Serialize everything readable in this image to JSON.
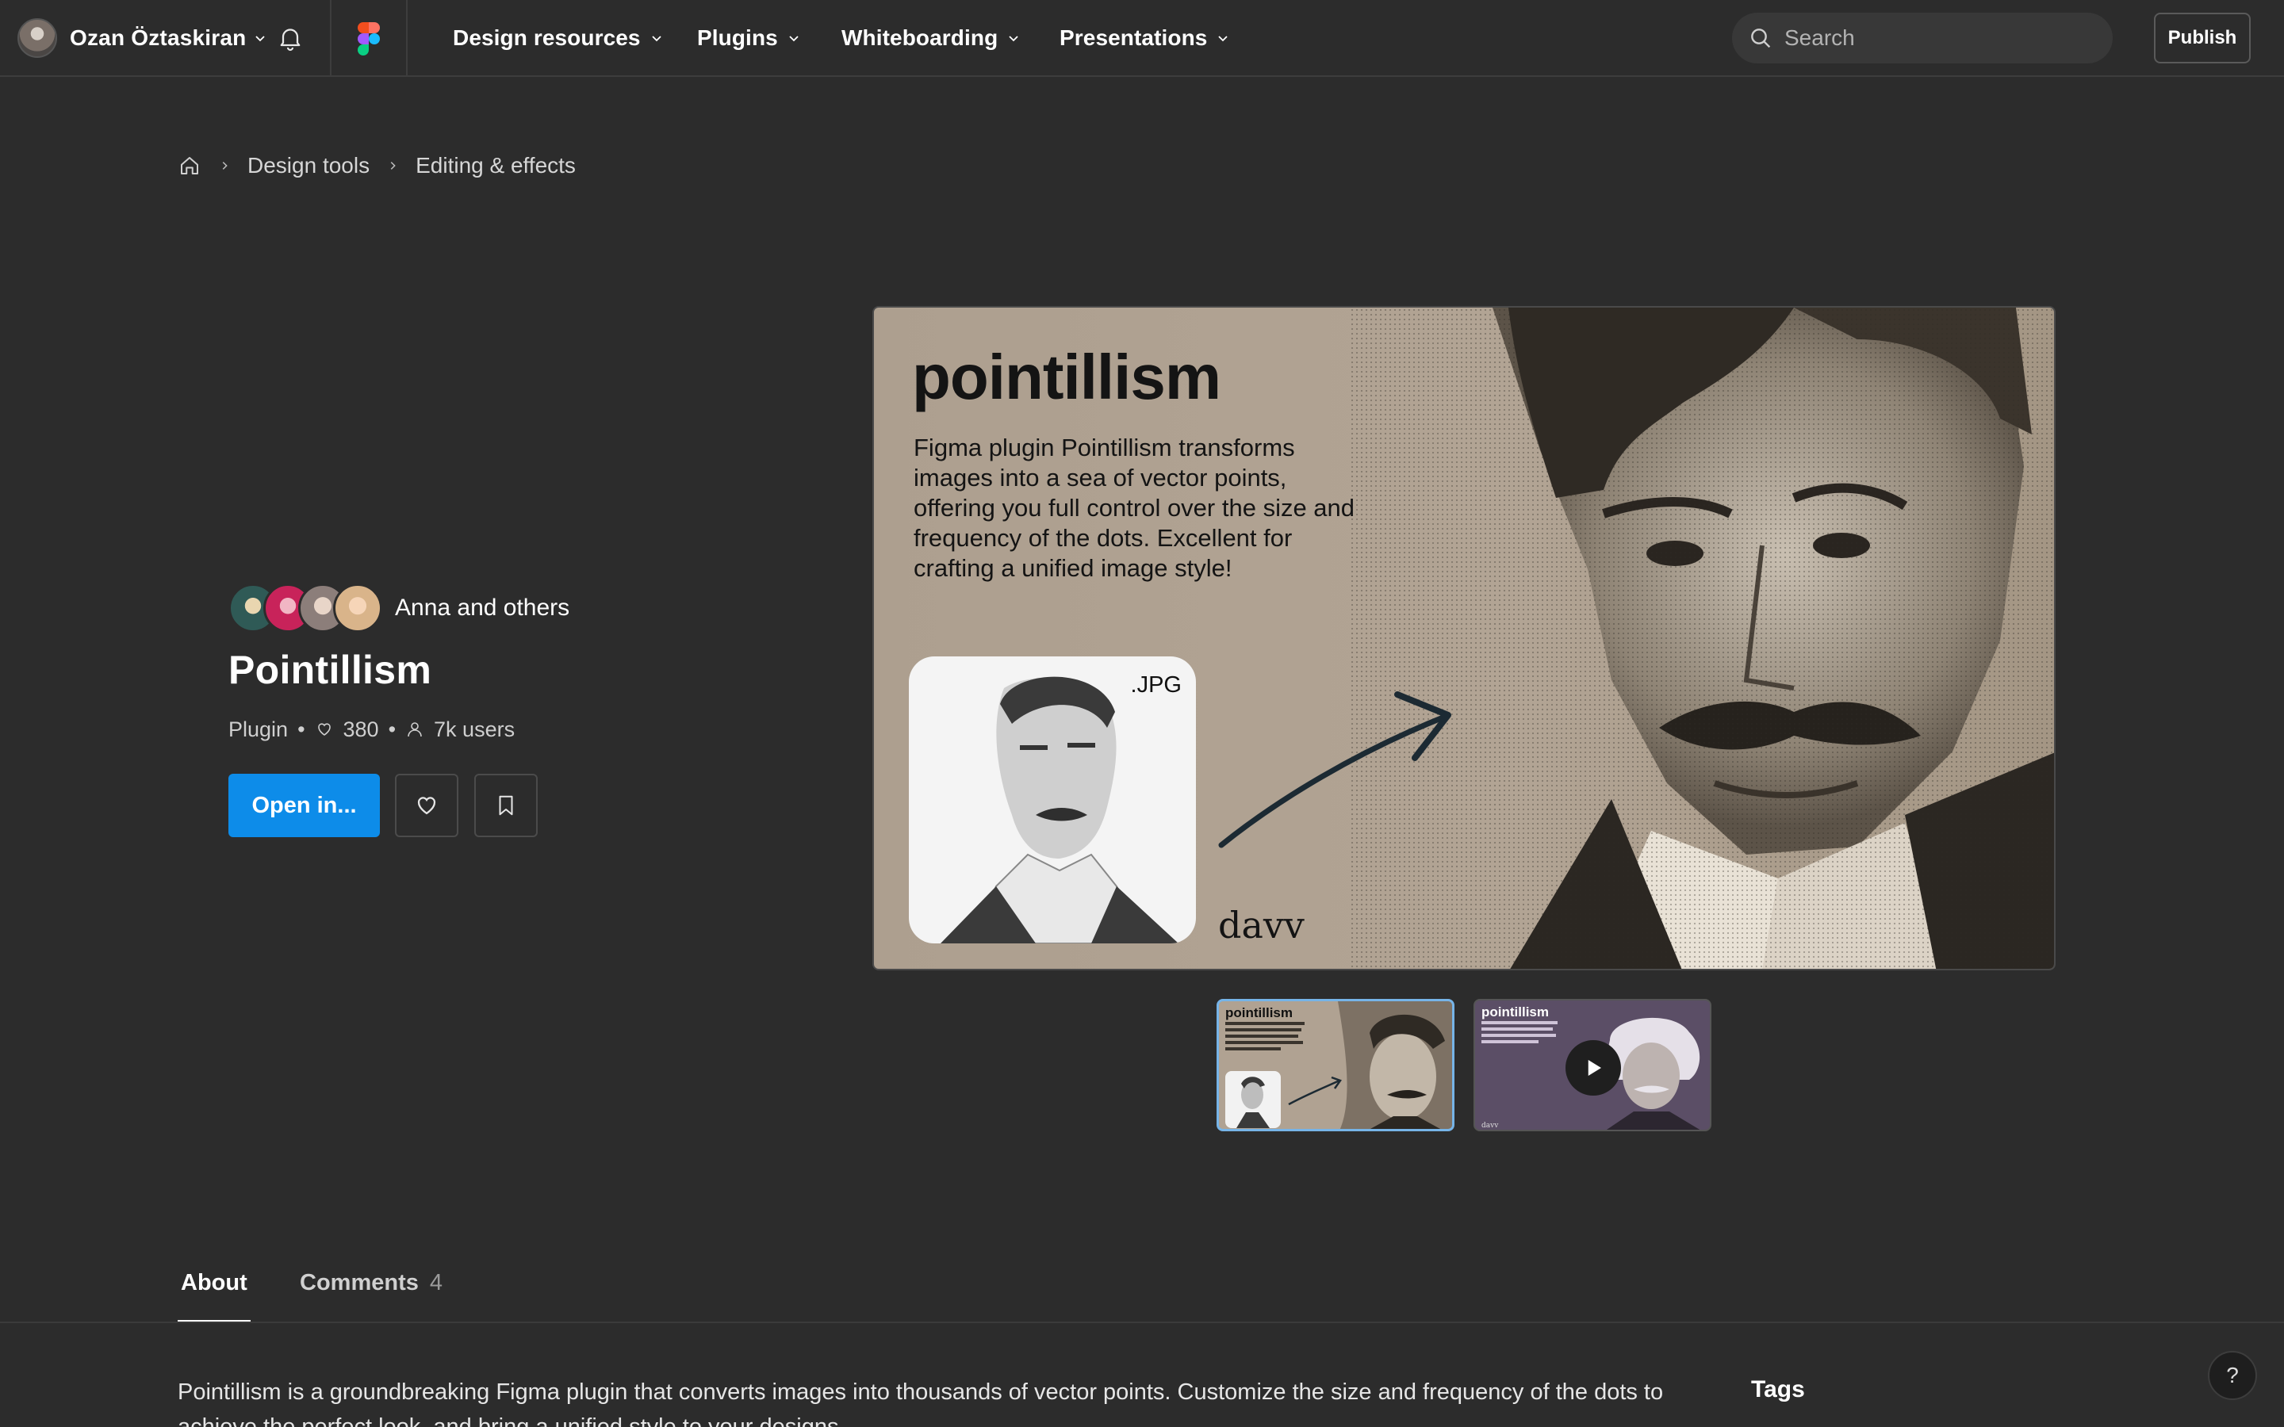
{
  "topbar": {
    "user_name": "Ozan Öztaskiran",
    "nav": [
      {
        "label": "Design resources"
      },
      {
        "label": "Plugins"
      },
      {
        "label": "Whiteboarding"
      },
      {
        "label": "Presentations"
      }
    ],
    "search_placeholder": "Search",
    "publish_label": "Publish"
  },
  "breadcrumb": {
    "items": [
      {
        "label": "Design tools"
      },
      {
        "label": "Editing & effects"
      }
    ]
  },
  "plugin": {
    "creators_label": "Anna and others",
    "title": "Pointillism",
    "type": "Plugin",
    "likes": "380",
    "users": "7k users",
    "open_label": "Open in..."
  },
  "hero": {
    "title": "pointillism",
    "description": "Figma plugin Pointillism transforms images into a sea of vector points, offering you full control over the size and frequency of the dots. Excellent for crafting a unified image style!",
    "jpg_tag": ".JPG",
    "signature": "davv",
    "thumb1_title": "pointillism",
    "thumb2_title": "pointillism"
  },
  "tabs": {
    "about": "About",
    "comments": "Comments",
    "comments_count": "4"
  },
  "about": {
    "text": "Pointillism is a groundbreaking Figma plugin that converts images into thousands of vector points. Customize the size and frequency of the dots to achieve the perfect look, and bring a unified style to your designs."
  },
  "sidebar": {
    "tags_heading": "Tags"
  },
  "help_label": "?",
  "colors": {
    "background": "#2c2c2c",
    "accent": "#0d8ce9",
    "hero_bg": "#ad9f8f"
  },
  "icons": [
    "chevron-down-icon",
    "bell-icon",
    "figma-logo-icon",
    "search-icon",
    "home-icon",
    "chevron-right-icon",
    "heart-icon",
    "user-icon",
    "bookmark-icon",
    "play-icon",
    "arrow-icon"
  ]
}
